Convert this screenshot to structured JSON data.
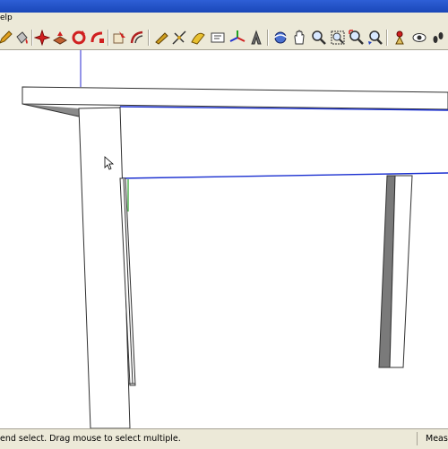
{
  "menubar": {
    "partial_label": "elp"
  },
  "toolbar": {
    "tools": [
      {
        "name": "pencil-tool-icon"
      },
      {
        "name": "paint-bucket-tool-icon"
      },
      {
        "name": "eraser-tool-icon"
      },
      {
        "name": "move-tool-icon"
      },
      {
        "name": "push-pull-tool-icon"
      },
      {
        "name": "rotate-tool-icon"
      },
      {
        "name": "follow-me-tool-icon"
      },
      {
        "name": "scale-tool-icon"
      },
      {
        "name": "offset-tool-icon"
      },
      {
        "name": "tape-measure-tool-icon"
      },
      {
        "name": "dimension-tool-icon"
      },
      {
        "name": "protractor-tool-icon"
      },
      {
        "name": "text-tool-icon"
      },
      {
        "name": "axes-tool-icon"
      },
      {
        "name": "3d-text-tool-icon"
      },
      {
        "name": "orbit-tool-icon"
      },
      {
        "name": "pan-tool-icon"
      },
      {
        "name": "zoom-tool-icon"
      },
      {
        "name": "zoom-window-tool-icon"
      },
      {
        "name": "zoom-extents-tool-icon"
      },
      {
        "name": "previous-view-icon"
      },
      {
        "name": "position-camera-icon"
      },
      {
        "name": "look-around-icon"
      },
      {
        "name": "walk-tool-icon"
      }
    ]
  },
  "statusbar": {
    "hint": "end select. Drag mouse to select multiple.",
    "measurements_label": "Measu"
  },
  "colors": {
    "titlebar": "#2553c9",
    "chrome": "#ece9d8",
    "selection_blue": "#1a2fd0",
    "leg_shadow": "#7a7a7a"
  }
}
